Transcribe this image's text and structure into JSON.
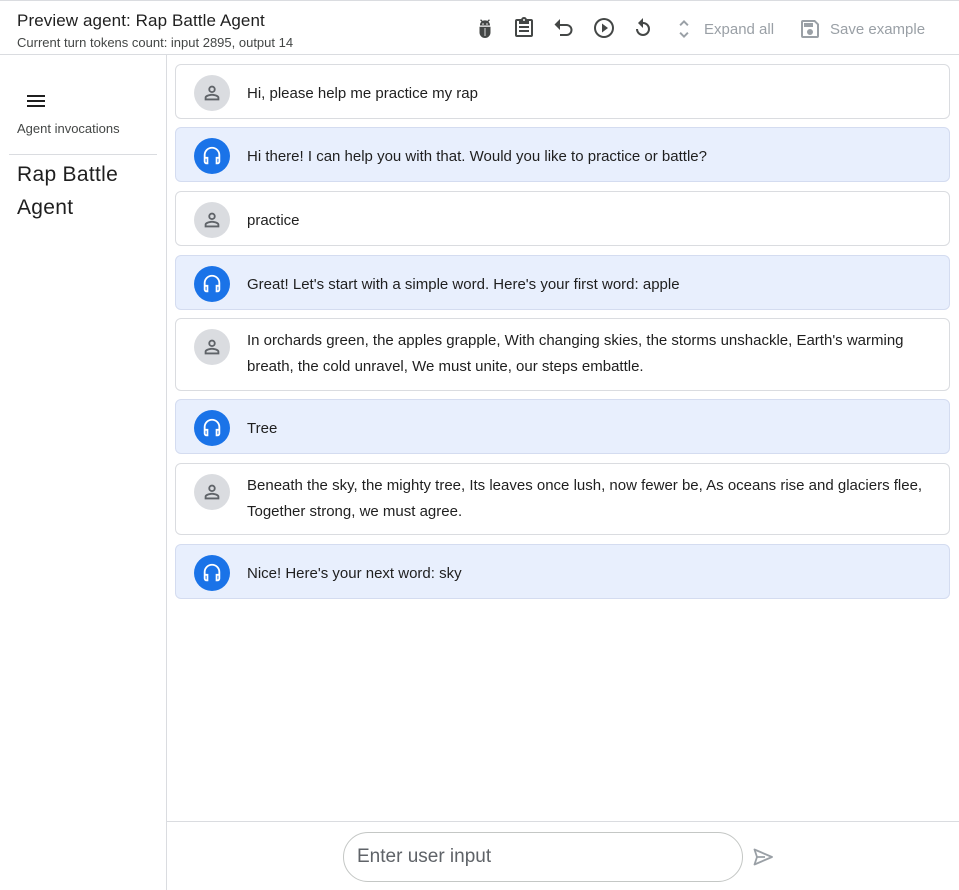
{
  "header": {
    "title": "Preview agent: Rap Battle Agent",
    "subtitle": "Current turn tokens count: input 2895, output 14",
    "toolbar": {
      "icons": [
        "bug-icon",
        "clipboard-icon",
        "undo-icon",
        "play-icon",
        "refresh-icon"
      ],
      "expand_all_label": "Expand all",
      "save_example_label": "Save example"
    }
  },
  "sidebar": {
    "caption": "Agent invocations",
    "agent_name": "Rap Battle Agent"
  },
  "messages": [
    {
      "role": "user",
      "text": "Hi, please help me practice my rap"
    },
    {
      "role": "agent",
      "text": "Hi there! I can help you with that. Would you like to practice or battle?"
    },
    {
      "role": "user",
      "text": "practice"
    },
    {
      "role": "agent",
      "text": "Great! Let's start with a simple word. Here's your first word: apple"
    },
    {
      "role": "user",
      "text": "In orchards green, the apples grapple, With changing skies, the storms unshackle, Earth's warming breath, the cold unravel, We must unite, our steps embattle."
    },
    {
      "role": "agent",
      "text": "Tree"
    },
    {
      "role": "user",
      "text": "Beneath the sky, the mighty tree, Its leaves once lush, now fewer be, As oceans rise and glaciers flee, Together strong, we must agree."
    },
    {
      "role": "agent",
      "text": "Nice! Here's your next word: sky"
    }
  ],
  "input": {
    "value": "",
    "placeholder": "Enter user input"
  },
  "colors": {
    "agent_bubble": "#e8effd",
    "agent_avatar": "#1a73e8",
    "user_avatar": "#dadce0",
    "disabled_text": "#9aa0a6"
  }
}
